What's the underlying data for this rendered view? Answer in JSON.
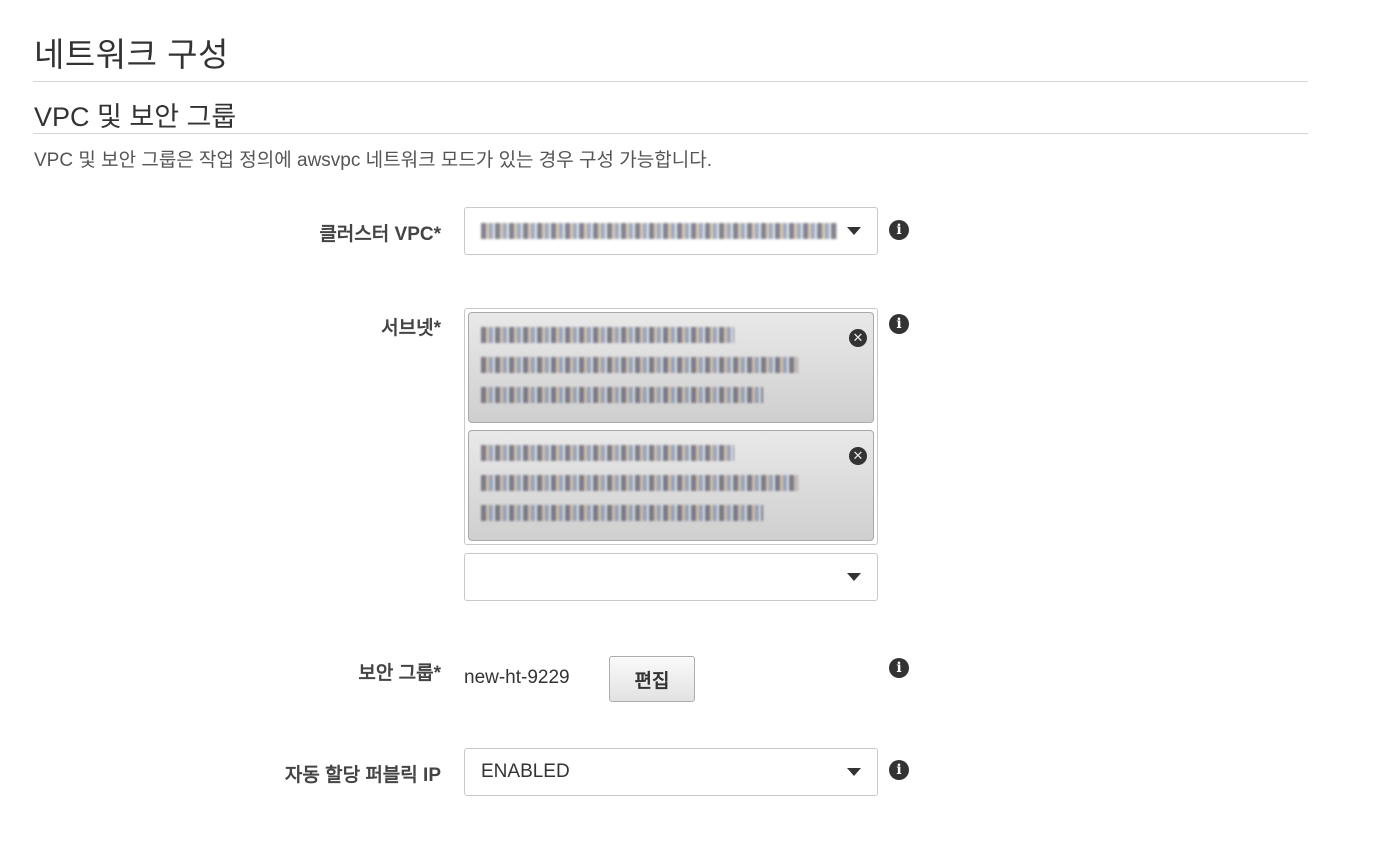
{
  "section": {
    "title": "네트워크 구성",
    "subtitle": "VPC 및 보안 그룹",
    "description": "VPC 및 보안 그룹은 작업 정의에 awsvpc 네트워크 모드가 있는 경우 구성 가능합니다."
  },
  "fields": {
    "vpc": {
      "label": "클러스터 VPC*"
    },
    "subnets": {
      "label": "서브넷*",
      "selected_count": 2
    },
    "security_group": {
      "label": "보안 그룹*",
      "value": "new-ht-9229",
      "edit_label": "편집"
    },
    "public_ip": {
      "label": "자동 할당 퍼블릭 IP",
      "value": "ENABLED"
    }
  },
  "icons": {
    "info": "info-icon",
    "dropdown": "chevron-down-icon",
    "remove": "close-icon"
  }
}
